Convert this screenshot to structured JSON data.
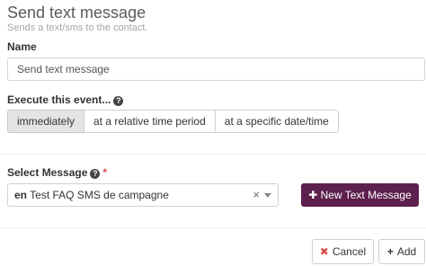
{
  "dialog": {
    "title": "Send text message",
    "subtitle": "Sends a text/sms to the contact."
  },
  "name_field": {
    "label": "Name",
    "value": "Send text message"
  },
  "event": {
    "label": "Execute this event...",
    "options": [
      "immediately",
      "at a relative time period",
      "at a specific date/time"
    ],
    "selected": "immediately"
  },
  "message": {
    "label": "Select Message",
    "required_marker": "*",
    "lang": "en",
    "value": "Test FAQ SMS de campagne",
    "clear_glyph": "×",
    "new_button": "New Text Message"
  },
  "footer": {
    "cancel": "Cancel",
    "add": "Add"
  },
  "icons": {
    "help": "question-circle-icon",
    "plus": "plus-icon",
    "times": "times-icon"
  },
  "colors": {
    "primary": "#5d1f4d",
    "danger": "#d9534f"
  }
}
